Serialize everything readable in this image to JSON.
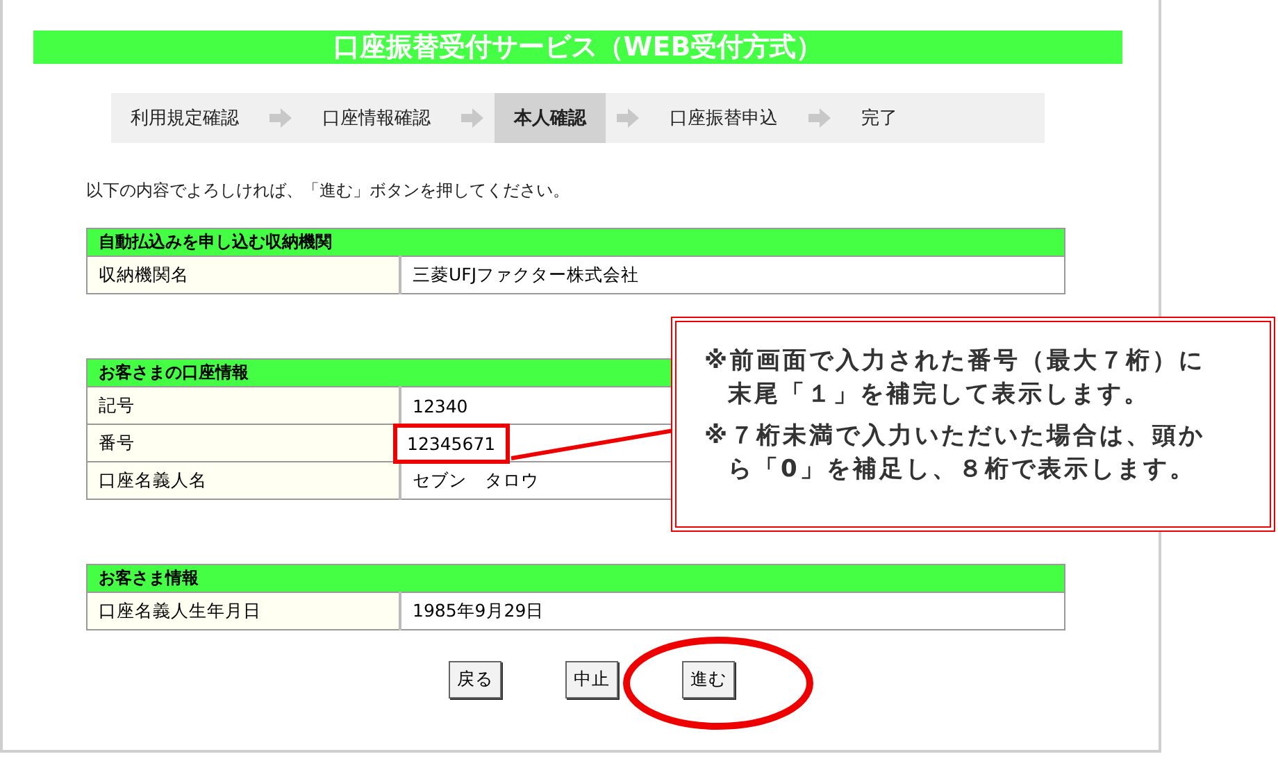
{
  "title": "口座振替受付サービス（WEB受付方式）",
  "steps": [
    {
      "label": "利用規定確認",
      "selected": false
    },
    {
      "label": "口座情報確認",
      "selected": false
    },
    {
      "label": "本人確認",
      "selected": true
    },
    {
      "label": "口座振替申込",
      "selected": false
    },
    {
      "label": "完了",
      "selected": false
    }
  ],
  "instruction": "以下の内容でよろしければ、「進む」ボタンを押してください。",
  "sections": [
    {
      "heading": "自動払込みを申し込む収納機関",
      "rows": [
        {
          "label": "収納機関名",
          "value": "三菱UFJファクター株式会社",
          "highlighted": false
        }
      ]
    },
    {
      "heading": "お客さまの口座情報",
      "rows": [
        {
          "label": "記号",
          "value": "12340",
          "highlighted": false
        },
        {
          "label": "番号",
          "value": "12345671",
          "highlighted": true
        },
        {
          "label": "口座名義人名",
          "value": "セブン　タロウ",
          "highlighted": false
        }
      ]
    },
    {
      "heading": "お客さま情報",
      "rows": [
        {
          "label": "口座名義人生年月日",
          "value": "1985年9月29日",
          "highlighted": false
        }
      ]
    }
  ],
  "buttons": [
    {
      "label": "戻る",
      "circled": false
    },
    {
      "label": "中止",
      "circled": false
    },
    {
      "label": "進む",
      "circled": true
    }
  ],
  "callout": {
    "notes": [
      "※前画面で入力された番号（最大７桁）に末尾「１」を補完して表示します。",
      "※７桁未満で入力いただいた場合は、頭から「0」を補足し、８桁で表示します。"
    ]
  }
}
